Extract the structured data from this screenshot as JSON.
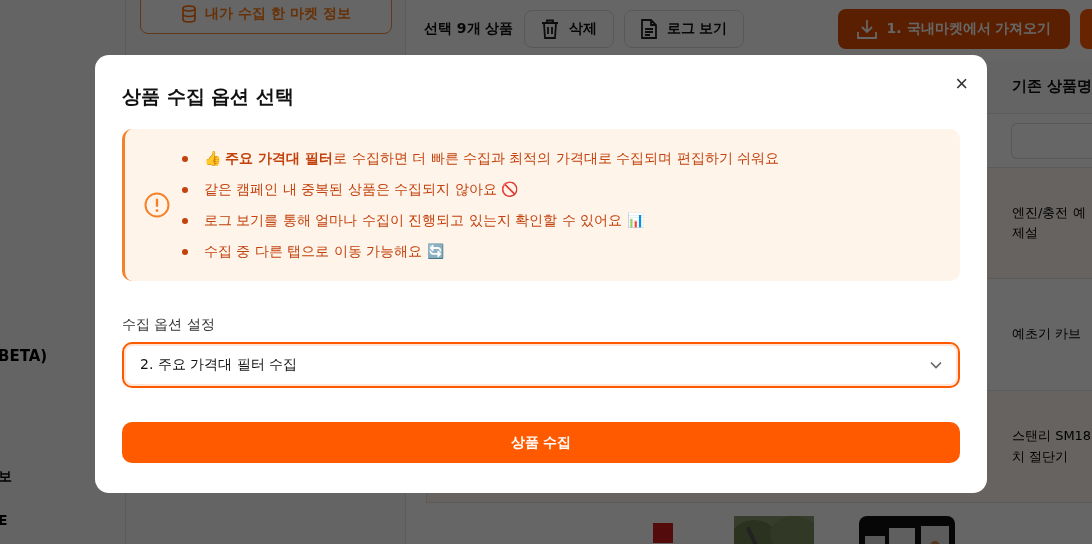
{
  "background": {
    "sidebar": {
      "items": [
        "BETA)",
        "보",
        "E"
      ]
    },
    "panel": {
      "market_button": "내가 수집 한 마켓 정보"
    },
    "toolbar": {
      "selection": "선택 9개 상품",
      "buttons": [
        {
          "label": "삭제",
          "kind": "delete"
        },
        {
          "label": "로그 보기",
          "kind": "log"
        }
      ],
      "import_button": "1. 국내마켓에서 가져오기"
    },
    "table": {
      "column": "기존 상품명",
      "rows": [
        {
          "name": "엔진/충전 예\n제설"
        },
        {
          "name": "예초기 카브"
        },
        {
          "name": "스탠리 SM18\n치 절단기"
        }
      ]
    }
  },
  "dialog": {
    "title": "상품 수집 옵션 선택",
    "close": "×",
    "notes": [
      "👍 **주요 가격대 필터**로 수집하면 더 빠른 수집과 최적의 가격대로 수집되며 편집하기 쉬워요",
      "같은 캠페인 내 중복된 상품은 수집되지 않아요 🚫",
      "로그 보기를 통해 얼마나 수집이 진행되고 있는지 확인할 수 있어요 📊",
      "수집 중 다른 탭으로 이동 가능해요 🔄"
    ],
    "option_label": "수집 옵션 설정",
    "option_select": {
      "value": "2. 주요 가격대 필터 수집",
      "focused": true
    },
    "submit": "상품 수집"
  }
}
